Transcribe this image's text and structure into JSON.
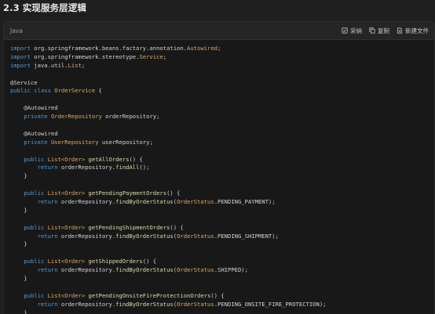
{
  "heading": "2.3 实现服务层逻辑",
  "code_block": {
    "language": "Java",
    "actions": [
      {
        "name": "adopt",
        "label": "采纳",
        "icon": "checkbox-icon"
      },
      {
        "name": "copy",
        "label": "复制",
        "icon": "copy-icon"
      },
      {
        "name": "new-file",
        "label": "新建文件",
        "icon": "new-file-icon"
      }
    ],
    "lines": [
      [
        {
          "t": "k",
          "v": "import "
        },
        {
          "t": "p",
          "v": "org.springframework.beans.factory.annotation."
        },
        {
          "t": "o",
          "v": "Autowired"
        },
        {
          "t": "p",
          "v": ";"
        }
      ],
      [
        {
          "t": "k",
          "v": "import "
        },
        {
          "t": "p",
          "v": "org.springframework.stereotype."
        },
        {
          "t": "o",
          "v": "Service"
        },
        {
          "t": "p",
          "v": ";"
        }
      ],
      [
        {
          "t": "k",
          "v": "import "
        },
        {
          "t": "p",
          "v": "java.util."
        },
        {
          "t": "o",
          "v": "List"
        },
        {
          "t": "p",
          "v": ";"
        }
      ],
      [],
      [
        {
          "t": "p",
          "v": "@Service"
        }
      ],
      [
        {
          "t": "k",
          "v": "public class "
        },
        {
          "t": "o",
          "v": "OrderService"
        },
        {
          "t": "p",
          "v": " {"
        }
      ],
      [],
      [
        {
          "t": "p",
          "v": "    @Autowired"
        }
      ],
      [
        {
          "t": "p",
          "v": "    "
        },
        {
          "t": "k",
          "v": "private "
        },
        {
          "t": "o",
          "v": "OrderRepository"
        },
        {
          "t": "p",
          "v": " orderRepository;"
        }
      ],
      [],
      [
        {
          "t": "p",
          "v": "    @Autowired"
        }
      ],
      [
        {
          "t": "p",
          "v": "    "
        },
        {
          "t": "k",
          "v": "private "
        },
        {
          "t": "o",
          "v": "UserRepository"
        },
        {
          "t": "p",
          "v": " userRepository;"
        }
      ],
      [],
      [
        {
          "t": "p",
          "v": "    "
        },
        {
          "t": "k",
          "v": "public "
        },
        {
          "t": "o",
          "v": "List<Order>"
        },
        {
          "t": "p",
          "v": " "
        },
        {
          "t": "f",
          "v": "getAllOrders"
        },
        {
          "t": "p",
          "v": "() {"
        }
      ],
      [
        {
          "t": "p",
          "v": "        "
        },
        {
          "t": "k",
          "v": "return "
        },
        {
          "t": "p",
          "v": "orderRepository."
        },
        {
          "t": "f",
          "v": "findAll"
        },
        {
          "t": "p",
          "v": "();"
        }
      ],
      [
        {
          "t": "p",
          "v": "    }"
        }
      ],
      [],
      [
        {
          "t": "p",
          "v": "    "
        },
        {
          "t": "k",
          "v": "public "
        },
        {
          "t": "o",
          "v": "List<Order>"
        },
        {
          "t": "p",
          "v": " "
        },
        {
          "t": "f",
          "v": "getPendingPaymentOrders"
        },
        {
          "t": "p",
          "v": "() {"
        }
      ],
      [
        {
          "t": "p",
          "v": "        "
        },
        {
          "t": "k",
          "v": "return "
        },
        {
          "t": "p",
          "v": "orderRepository."
        },
        {
          "t": "f",
          "v": "findByOrderStatus"
        },
        {
          "t": "p",
          "v": "("
        },
        {
          "t": "o",
          "v": "OrderStatus"
        },
        {
          "t": "p",
          "v": ".PENDING_PAYMENT);"
        }
      ],
      [
        {
          "t": "p",
          "v": "    }"
        }
      ],
      [],
      [
        {
          "t": "p",
          "v": "    "
        },
        {
          "t": "k",
          "v": "public "
        },
        {
          "t": "o",
          "v": "List<Order>"
        },
        {
          "t": "p",
          "v": " "
        },
        {
          "t": "f",
          "v": "getPendingShipmentOrders"
        },
        {
          "t": "p",
          "v": "() {"
        }
      ],
      [
        {
          "t": "p",
          "v": "        "
        },
        {
          "t": "k",
          "v": "return "
        },
        {
          "t": "p",
          "v": "orderRepository."
        },
        {
          "t": "f",
          "v": "findByOrderStatus"
        },
        {
          "t": "p",
          "v": "("
        },
        {
          "t": "o",
          "v": "OrderStatus"
        },
        {
          "t": "p",
          "v": ".PENDING_SHIPMENT);"
        }
      ],
      [
        {
          "t": "p",
          "v": "    }"
        }
      ],
      [],
      [
        {
          "t": "p",
          "v": "    "
        },
        {
          "t": "k",
          "v": "public "
        },
        {
          "t": "o",
          "v": "List<Order>"
        },
        {
          "t": "p",
          "v": " "
        },
        {
          "t": "f",
          "v": "getShippedOrders"
        },
        {
          "t": "p",
          "v": "() {"
        }
      ],
      [
        {
          "t": "p",
          "v": "        "
        },
        {
          "t": "k",
          "v": "return "
        },
        {
          "t": "p",
          "v": "orderRepository."
        },
        {
          "t": "f",
          "v": "findByOrderStatus"
        },
        {
          "t": "p",
          "v": "("
        },
        {
          "t": "o",
          "v": "OrderStatus"
        },
        {
          "t": "p",
          "v": ".SHIPPED);"
        }
      ],
      [
        {
          "t": "p",
          "v": "    }"
        }
      ],
      [],
      [
        {
          "t": "p",
          "v": "    "
        },
        {
          "t": "k",
          "v": "public "
        },
        {
          "t": "o",
          "v": "List<Order>"
        },
        {
          "t": "p",
          "v": " "
        },
        {
          "t": "f",
          "v": "getPendingOnsiteFireProtectionOrders"
        },
        {
          "t": "p",
          "v": "() {"
        }
      ],
      [
        {
          "t": "p",
          "v": "        "
        },
        {
          "t": "k",
          "v": "return "
        },
        {
          "t": "p",
          "v": "orderRepository."
        },
        {
          "t": "f",
          "v": "findByOrderStatus"
        },
        {
          "t": "p",
          "v": "("
        },
        {
          "t": "o",
          "v": "OrderStatus"
        },
        {
          "t": "p",
          "v": ".PENDING_ONSITE_FIRE_PROTECTION);"
        }
      ],
      [
        {
          "t": "p",
          "v": "    }"
        }
      ]
    ]
  },
  "colors": {
    "background": "#1f1f1f",
    "code_background": "#181818",
    "header_background": "#252526",
    "keyword": "#569cd6",
    "type_orange": "#e3a85f",
    "method": "#dcdcaa",
    "plain": "#d4d4d4"
  }
}
